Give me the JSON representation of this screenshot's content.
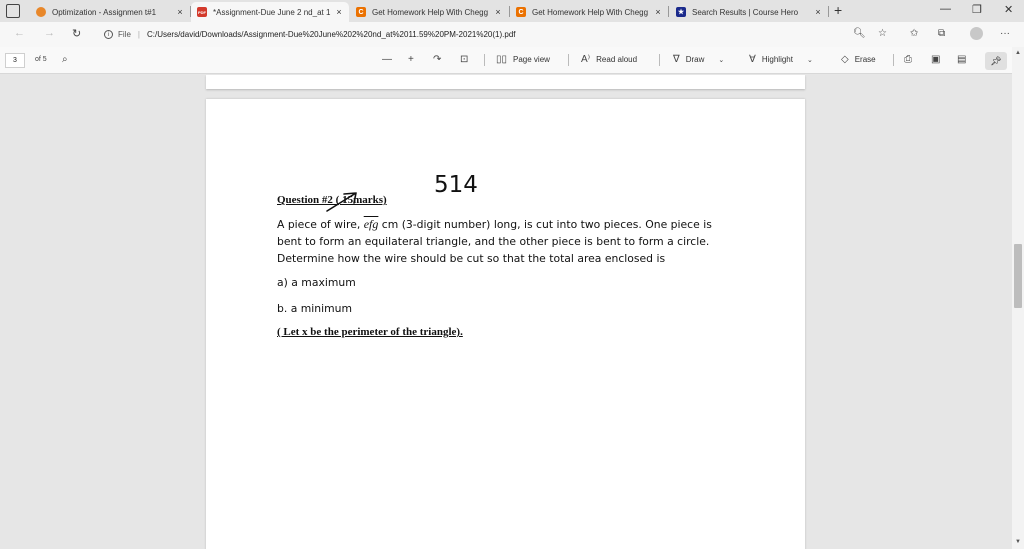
{
  "tabs": [
    {
      "title": "Optimization - Assignmen t#1",
      "close": "×",
      "favicon_color": "#e8872a",
      "favicon_glyph": ""
    },
    {
      "title": "*Assignment-Due June 2 nd_at 1",
      "close": "×",
      "favicon_color": "#d33a2c",
      "favicon_glyph": "PDF"
    },
    {
      "title": "Get Homework Help With Chegg",
      "close": "×",
      "favicon_color": "#eb7100",
      "favicon_glyph": "C"
    },
    {
      "title": "Get Homework Help With Chegg",
      "close": "×",
      "favicon_color": "#eb7100",
      "favicon_glyph": "C"
    },
    {
      "title": "Search Results | Course Hero",
      "close": "×",
      "favicon_color": "#1b2a8c",
      "favicon_glyph": "★"
    }
  ],
  "new_tab": "+",
  "address": {
    "scheme": "File",
    "url": "C:/Users/david/Downloads/Assignment-Due%20June%202%20nd_at%2011.59%20PM-2021%20(1).pdf"
  },
  "pdf_toolbar": {
    "page_current": "3",
    "page_total": "of 5",
    "page_view": "Page view",
    "read_aloud": "Read aloud",
    "draw": "Draw",
    "highlight": "Highlight",
    "erase": "Erase"
  },
  "document": {
    "question_heading": "Question #2 ( 15marks)",
    "handwritten_note": "514",
    "line1_prefix": "A piece of wire, ",
    "variable": "efg",
    "line1_suffix": " cm (3-digit number) long, is cut into two pieces. One piece is",
    "line2": "bent to form an equilateral triangle, and the other piece is bent to form a circle.",
    "line3": "Determine how the wire should be cut so that the total area enclosed is",
    "option_a": "a)  a maximum",
    "option_b": "b. a minimum",
    "hint": "( Let x be the perimeter of the triangle)."
  },
  "icons": [
    "tab-actions-icon",
    "back-icon",
    "forward-icon",
    "refresh-icon",
    "info-icon",
    "search-icon",
    "zoom-icon",
    "favorites-add-icon",
    "favorites-icon",
    "collections-icon",
    "profile-icon",
    "more-icon",
    "zoom-out-icon",
    "zoom-in-icon",
    "rotate-icon",
    "fit-icon",
    "page-view-icon",
    "read-aloud-icon",
    "draw-icon",
    "highlight-icon",
    "erase-icon",
    "print-icon",
    "save-icon",
    "save-as-icon",
    "pin-icon"
  ]
}
